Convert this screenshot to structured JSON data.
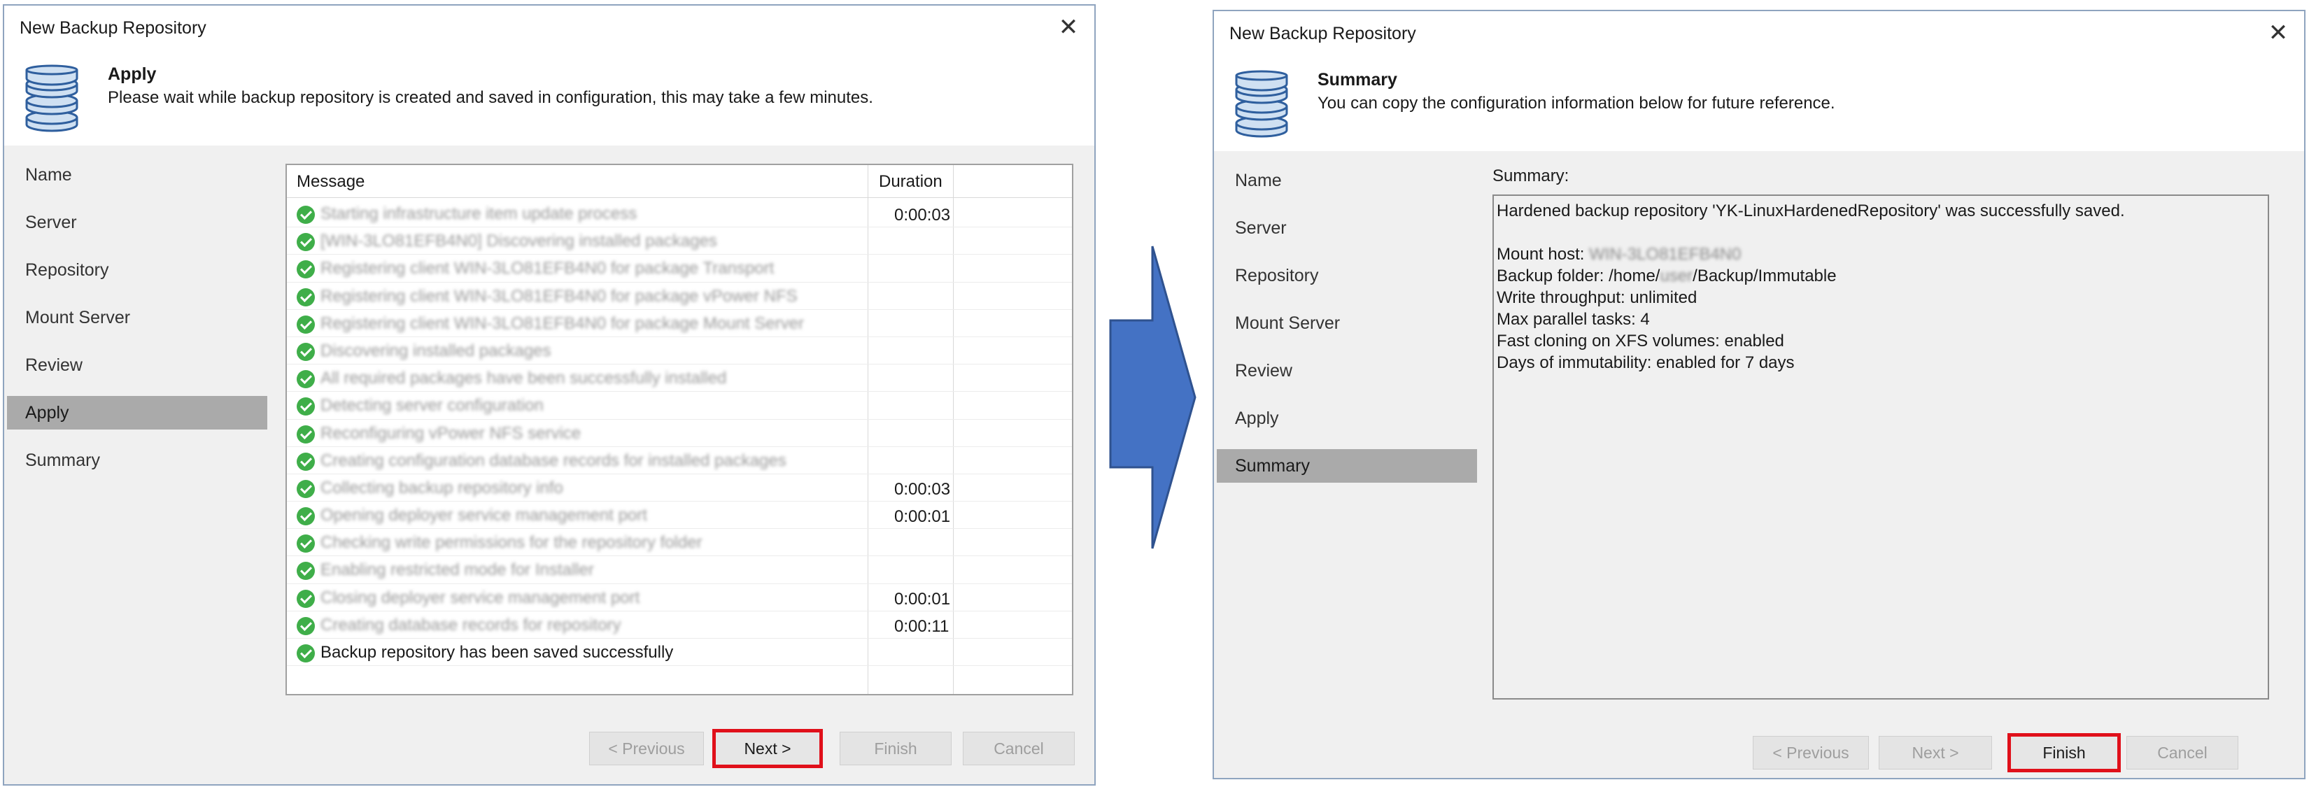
{
  "left_dialog": {
    "title": "New Backup Repository",
    "header": {
      "title": "Apply",
      "description": "Please wait while backup repository is created and saved in configuration, this may take a few minutes."
    },
    "sidebar": [
      "Name",
      "Server",
      "Repository",
      "Mount Server",
      "Review",
      "Apply",
      "Summary"
    ],
    "active_step": "Apply",
    "table": {
      "columns": [
        "Message",
        "Duration"
      ],
      "rows": [
        {
          "message": "Starting infrastructure item update process",
          "duration": "0:00:03",
          "blurred": true
        },
        {
          "message": "[WIN-3LO81EFB4N0] Discovering installed packages",
          "duration": "",
          "blurred": true
        },
        {
          "message": "Registering client WIN-3LO81EFB4N0 for package Transport",
          "duration": "",
          "blurred": true
        },
        {
          "message": "Registering client WIN-3LO81EFB4N0 for package vPower NFS",
          "duration": "",
          "blurred": true
        },
        {
          "message": "Registering client WIN-3LO81EFB4N0 for package Mount Server",
          "duration": "",
          "blurred": true
        },
        {
          "message": "Discovering installed packages",
          "duration": "",
          "blurred": true
        },
        {
          "message": "All required packages have been successfully installed",
          "duration": "",
          "blurred": true
        },
        {
          "message": "Detecting server configuration",
          "duration": "",
          "blurred": true
        },
        {
          "message": "Reconfiguring vPower NFS service",
          "duration": "",
          "blurred": true
        },
        {
          "message": "Creating configuration database records for installed packages",
          "duration": "",
          "blurred": true
        },
        {
          "message": "Collecting backup repository info",
          "duration": "0:00:03",
          "blurred": true
        },
        {
          "message": "Opening deployer service management port",
          "duration": "0:00:01",
          "blurred": true
        },
        {
          "message": "Checking write permissions for the repository folder",
          "duration": "",
          "blurred": true
        },
        {
          "message": "Enabling restricted mode for Installer",
          "duration": "",
          "blurred": true
        },
        {
          "message": "Closing deployer service management port",
          "duration": "0:00:01",
          "blurred": true
        },
        {
          "message": "Creating database records for repository",
          "duration": "0:00:11",
          "blurred": true
        },
        {
          "message": "Backup repository has been saved successfully",
          "duration": "",
          "blurred": false
        }
      ]
    },
    "buttons": {
      "previous": "< Previous",
      "next": "Next >",
      "finish": "Finish",
      "cancel": "Cancel"
    }
  },
  "right_dialog": {
    "title": "New Backup Repository",
    "header": {
      "title": "Summary",
      "description": "You can copy the configuration information below for future reference."
    },
    "sidebar": [
      "Name",
      "Server",
      "Repository",
      "Mount Server",
      "Review",
      "Apply",
      "Summary"
    ],
    "active_step": "Summary",
    "summary_label": "Summary:",
    "summary": {
      "saved_line": "Hardened backup repository 'YK-LinuxHardenedRepository' was successfully saved.",
      "mount_host_label": "Mount host:",
      "mount_host_value": "WIN-3LO81EFB4N0",
      "backup_folder_prefix": "Backup folder: /home/",
      "backup_folder_user": "user",
      "backup_folder_suffix": "/Backup/Immutable",
      "write_throughput": "Write throughput: unlimited",
      "max_parallel": "Max parallel tasks: 4",
      "fast_cloning": "Fast cloning on XFS volumes: enabled",
      "immutability": "Days of immutability: enabled for 7 days"
    },
    "buttons": {
      "previous": "< Previous",
      "next": "Next >",
      "finish": "Finish",
      "cancel": "Cancel"
    }
  },
  "colors": {
    "highlight": "#e0101a",
    "arrow": "#4472c4",
    "success": "#3fae49",
    "active_step": "#aaaaaa"
  },
  "icons": {
    "header": "database-icon",
    "row_status": "check-circle-icon",
    "close": "close-icon",
    "transition": "right-arrow"
  }
}
